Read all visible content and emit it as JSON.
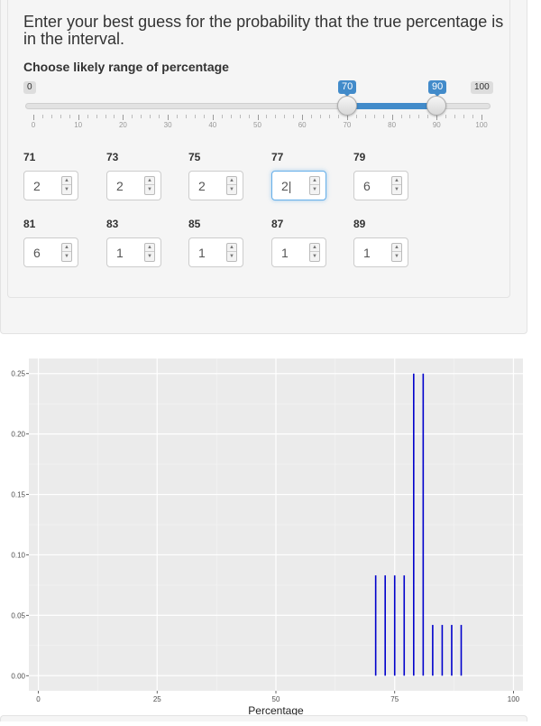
{
  "question": "Enter your best guess for the probability that the true percentage is in the interval.",
  "range": {
    "label": "Choose likely range of percentage",
    "min": 0,
    "max": 100,
    "from": 70,
    "to": 90,
    "min_label": "0",
    "max_label": "100",
    "from_label": "70",
    "to_label": "90",
    "tick_labels": [
      "0",
      "10",
      "20",
      "30",
      "40",
      "50",
      "60",
      "70",
      "80",
      "90",
      "100"
    ]
  },
  "inputs": [
    {
      "label": "71",
      "value": "2"
    },
    {
      "label": "73",
      "value": "2"
    },
    {
      "label": "75",
      "value": "2"
    },
    {
      "label": "77",
      "value": "2",
      "focused": true
    },
    {
      "label": "79",
      "value": "6"
    },
    {
      "label": "81",
      "value": "6"
    },
    {
      "label": "83",
      "value": "1"
    },
    {
      "label": "85",
      "value": "1"
    },
    {
      "label": "87",
      "value": "1"
    },
    {
      "label": "89",
      "value": "1"
    }
  ],
  "colors": {
    "accent": "#428bca",
    "plot_panel": "#ebebeb",
    "bar": "#0000cc"
  },
  "chart_data": {
    "type": "bar",
    "x": [
      71,
      73,
      75,
      77,
      79,
      81,
      83,
      85,
      87,
      89
    ],
    "values": [
      0.083,
      0.083,
      0.083,
      0.083,
      0.25,
      0.25,
      0.042,
      0.042,
      0.042,
      0.042
    ],
    "xlabel": "Percentage",
    "ylabel": "",
    "xlim": [
      -2,
      102
    ],
    "ylim": [
      -0.0125,
      0.2625
    ],
    "x_ticks": [
      0,
      25,
      50,
      75,
      100
    ],
    "x_tick_labels": [
      "0",
      "25",
      "50",
      "75",
      "100"
    ],
    "y_ticks": [
      0,
      0.05,
      0.1,
      0.15,
      0.2,
      0.25
    ],
    "y_tick_labels": [
      "0.00",
      "0.05",
      "0.10",
      "0.15",
      "0.20",
      "0.25"
    ],
    "grid": true
  }
}
